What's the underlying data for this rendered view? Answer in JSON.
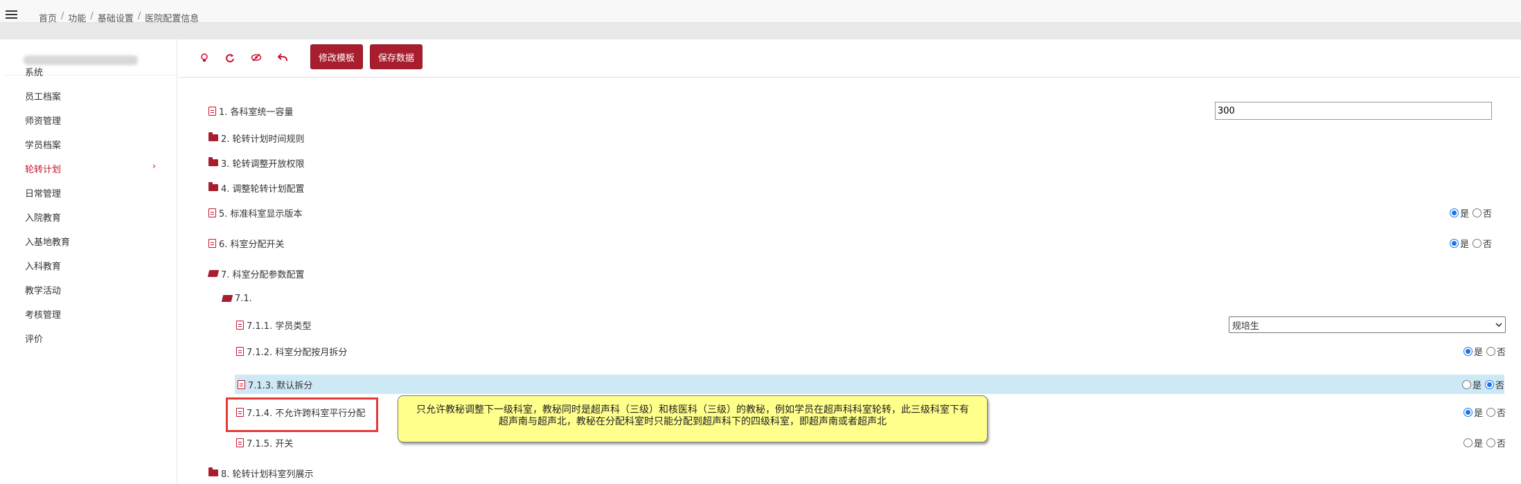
{
  "breadcrumb": {
    "items": [
      "首页",
      "功能",
      "基础设置",
      "医院配置信息"
    ],
    "separator": "/"
  },
  "sidebar": {
    "items": [
      {
        "label": "系统"
      },
      {
        "label": "员工档案"
      },
      {
        "label": "师资管理"
      },
      {
        "label": "学员档案"
      },
      {
        "label": "轮转计划",
        "active": true
      },
      {
        "label": "日常管理"
      },
      {
        "label": "入院教育"
      },
      {
        "label": "入基地教育"
      },
      {
        "label": "入科教育"
      },
      {
        "label": "教学活动"
      },
      {
        "label": "考核管理"
      },
      {
        "label": "评价"
      }
    ],
    "chevron": "›"
  },
  "toolbar": {
    "icons": [
      "lightbulb-icon",
      "refresh-icon",
      "eye-slash-icon",
      "undo-icon"
    ],
    "edit_template_label": "修改模板",
    "save_data_label": "保存数据"
  },
  "radio_labels": {
    "yes": "是",
    "no": "否"
  },
  "tree": {
    "item1": {
      "label": "1. 各科室统一容量",
      "value": "300"
    },
    "item2": {
      "label": "2. 轮转计划时间规则"
    },
    "item3": {
      "label": "3. 轮转调整开放权限"
    },
    "item4": {
      "label": "4. 调整轮转计划配置"
    },
    "item5": {
      "label": "5. 标准科室显示版本",
      "selected": "是"
    },
    "item6": {
      "label": "6. 科室分配开关",
      "selected": "是"
    },
    "item7": {
      "label": "7. 科室分配参数配置"
    },
    "item71": {
      "label": "7.1."
    },
    "item711": {
      "label": "7.1.1. 学员类型",
      "value": "规培生"
    },
    "item712": {
      "label": "7.1.2. 科室分配按月拆分",
      "selected": "是"
    },
    "item713": {
      "label": "7.1.3. 默认拆分",
      "selected": "否"
    },
    "item714": {
      "label": "7.1.4. 不允许跨科室平行分配",
      "selected": "是"
    },
    "item715": {
      "label": "7.1.5. 开关",
      "selected": null
    },
    "item8": {
      "label": "8. 轮转计划科室列展示"
    }
  },
  "tooltip": {
    "text": "只允许教秘调整下一级科室，教秘同时是超声科（三级）和核医科（三级）的教秘，例如学员在超声科科室轮转，此三级科室下有超声南与超声北，教秘在分配科室时只能分配到超声科下的四级科室，即超声南或者超声北"
  },
  "colors": {
    "accent": "#a81e2e",
    "active_text": "#c8102e",
    "highlight_row": "#cde9f6",
    "tooltip_bg": "#ffff8c",
    "annotation_box": "#e53935"
  }
}
